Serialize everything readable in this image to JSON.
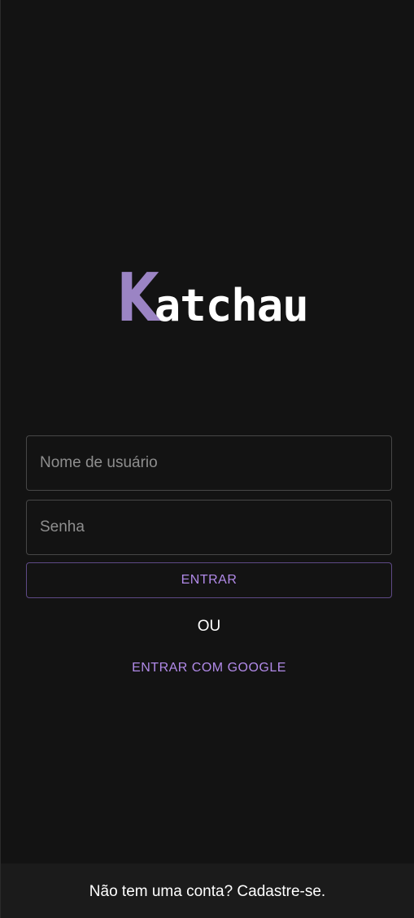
{
  "logo": {
    "initial": "K",
    "rest": "atchau",
    "accent_color": "#9b84c4"
  },
  "login_form": {
    "username_placeholder": "Nome de usuário",
    "username_value": "",
    "password_placeholder": "Senha",
    "password_value": "",
    "submit_label": "ENTRAR",
    "divider_text": "OU",
    "google_label": "ENTRAR COM GOOGLE"
  },
  "footer": {
    "signup_text": "Não tem uma conta? Cadastre-se."
  },
  "colors": {
    "background": "#131313",
    "accent": "#b18ae8",
    "footer_background": "#1b1b1b"
  }
}
